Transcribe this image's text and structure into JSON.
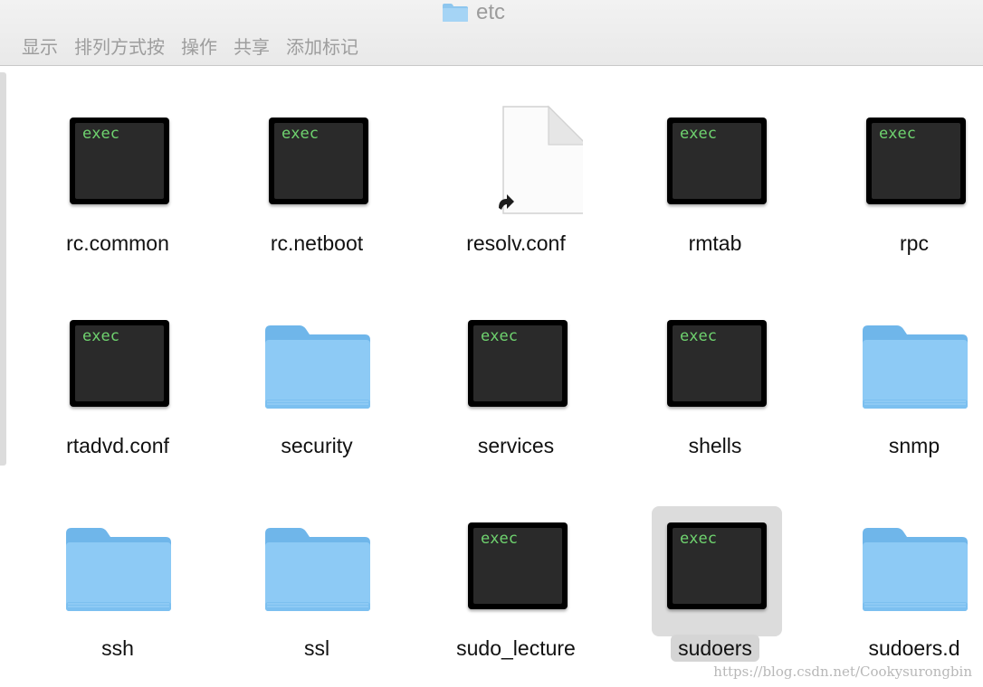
{
  "window": {
    "title": "etc"
  },
  "toolbar": {
    "items": [
      "显示",
      "排列方式",
      "按",
      "操作",
      "共享",
      "添加标记"
    ]
  },
  "icons": {
    "exec_text": "exec"
  },
  "files": [
    {
      "name": "rc.common",
      "type": "exec"
    },
    {
      "name": "rc.netboot",
      "type": "exec"
    },
    {
      "name": "resolv.conf",
      "type": "alias-document"
    },
    {
      "name": "rmtab",
      "type": "exec"
    },
    {
      "name": "rpc",
      "type": "exec"
    },
    {
      "name": "rtadvd.conf",
      "type": "exec"
    },
    {
      "name": "security",
      "type": "folder"
    },
    {
      "name": "services",
      "type": "exec"
    },
    {
      "name": "shells",
      "type": "exec"
    },
    {
      "name": "snmp",
      "type": "folder"
    },
    {
      "name": "ssh",
      "type": "folder"
    },
    {
      "name": "ssl",
      "type": "folder"
    },
    {
      "name": "sudo_lecture",
      "type": "exec"
    },
    {
      "name": "sudoers",
      "type": "exec",
      "selected": true
    },
    {
      "name": "sudoers.d",
      "type": "folder"
    }
  ],
  "watermark": "https://blog.csdn.net/Cookysurongbin",
  "colors": {
    "folder_blue": "#8dcaf5",
    "exec_green": "#6fd36f",
    "selection_gray": "#dcdcdc"
  }
}
